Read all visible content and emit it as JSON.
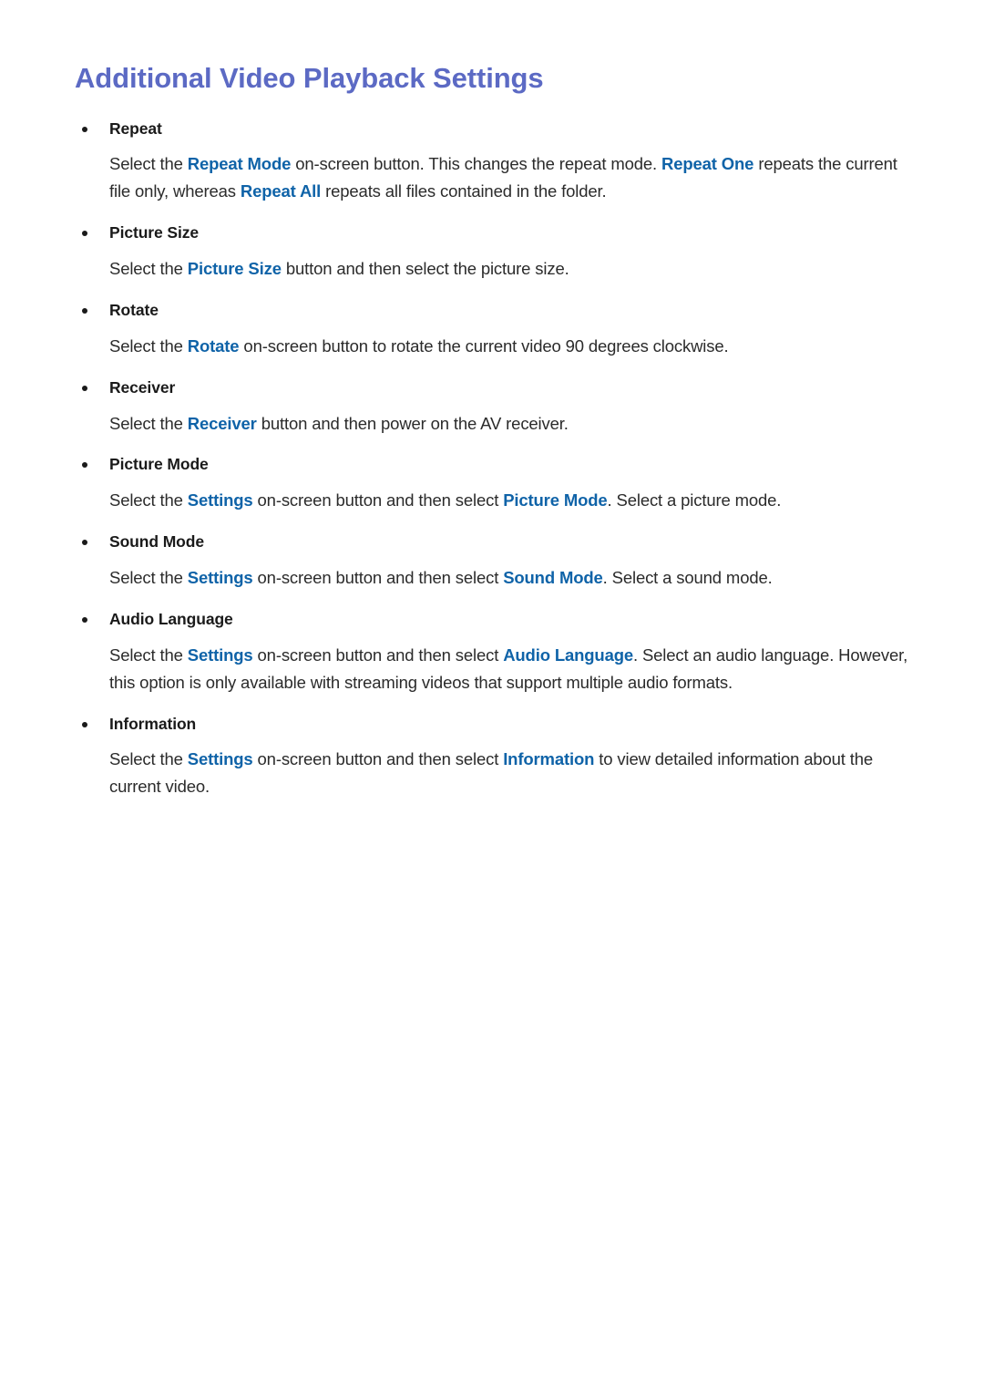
{
  "document": {
    "title": "Additional Video Playback Settings",
    "accent_heading_color": "#5c6ac4",
    "accent_term_color": "#0f63a8",
    "body_text_color": "#2b2b2b",
    "background_color": "#ffffff",
    "bullet_icon": "bullet-dot-icon"
  },
  "sections": [
    {
      "label": "Repeat",
      "body_runs": [
        {
          "text": "Select the ",
          "style": "normal"
        },
        {
          "text": "Repeat Mode",
          "style": "term"
        },
        {
          "text": " on-screen button. This changes the repeat mode. ",
          "style": "normal"
        },
        {
          "text": "Repeat One",
          "style": "term"
        },
        {
          "text": " repeats the current file only, whereas ",
          "style": "normal"
        },
        {
          "text": "Repeat All",
          "style": "term"
        },
        {
          "text": " repeats all files contained in the folder.",
          "style": "normal"
        }
      ]
    },
    {
      "label": "Picture Size",
      "body_runs": [
        {
          "text": "Select the ",
          "style": "normal"
        },
        {
          "text": "Picture Size",
          "style": "term"
        },
        {
          "text": " button and then select the picture size.",
          "style": "normal"
        }
      ]
    },
    {
      "label": "Rotate",
      "body_runs": [
        {
          "text": "Select the ",
          "style": "normal"
        },
        {
          "text": "Rotate",
          "style": "term"
        },
        {
          "text": " on-screen button to rotate the current video 90 degrees clockwise.",
          "style": "normal"
        }
      ]
    },
    {
      "label": "Receiver",
      "body_runs": [
        {
          "text": "Select the ",
          "style": "normal"
        },
        {
          "text": "Receiver",
          "style": "term"
        },
        {
          "text": " button and then power on the AV receiver.",
          "style": "normal"
        }
      ]
    },
    {
      "label": "Picture Mode",
      "body_runs": [
        {
          "text": "Select the ",
          "style": "normal"
        },
        {
          "text": "Settings",
          "style": "term"
        },
        {
          "text": " on-screen button and then select ",
          "style": "normal"
        },
        {
          "text": "Picture Mode",
          "style": "term"
        },
        {
          "text": ". Select a picture mode.",
          "style": "normal"
        }
      ]
    },
    {
      "label": "Sound Mode",
      "body_runs": [
        {
          "text": "Select the ",
          "style": "normal"
        },
        {
          "text": "Settings",
          "style": "term"
        },
        {
          "text": " on-screen button and then select ",
          "style": "normal"
        },
        {
          "text": "Sound Mode",
          "style": "term"
        },
        {
          "text": ". Select a sound mode.",
          "style": "normal"
        }
      ]
    },
    {
      "label": "Audio Language",
      "body_runs": [
        {
          "text": "Select the ",
          "style": "normal"
        },
        {
          "text": "Settings",
          "style": "term"
        },
        {
          "text": " on-screen button and then select ",
          "style": "normal"
        },
        {
          "text": "Audio Language",
          "style": "term"
        },
        {
          "text": ". Select an audio language. However, this option is only available with streaming videos that support multiple audio formats.",
          "style": "normal"
        }
      ]
    },
    {
      "label": "Information",
      "body_runs": [
        {
          "text": "Select the ",
          "style": "normal"
        },
        {
          "text": "Settings",
          "style": "term"
        },
        {
          "text": " on-screen button and then select ",
          "style": "normal"
        },
        {
          "text": "Information",
          "style": "term"
        },
        {
          "text": " to view detailed information about the current video.",
          "style": "normal"
        }
      ]
    }
  ]
}
